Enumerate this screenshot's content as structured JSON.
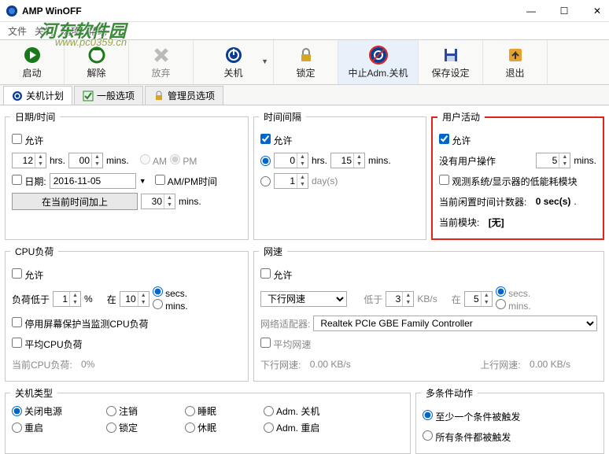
{
  "title": "AMP WinOFF",
  "menu": {
    "file": "文件",
    "shutdown": "关机",
    "options": "选项",
    "help": "帮助"
  },
  "watermark": {
    "line1": "河东软件园",
    "line2": "www.pc0359.cn"
  },
  "toolbar": {
    "start": "启动",
    "cancel": "解除",
    "abort": "放弃",
    "shut": "关机",
    "lock": "锁定",
    "admShut": "中止Adm.关机",
    "save": "保存设定",
    "exit": "退出"
  },
  "tabs": {
    "plan": "关机计划",
    "general": "一般选项",
    "admin": "管理员选项"
  },
  "datetime": {
    "title": "日期/时间",
    "allow": "允许",
    "hrs": "12",
    "hrsLbl": "hrs.",
    "mins": "00",
    "minsLbl": "mins.",
    "am": "AM",
    "pm": "PM",
    "dateChk": "日期:",
    "dateVal": "2016-11-05",
    "ampm": "AM/PM时间",
    "addBtn": "在当前时间加上",
    "addVal": "30",
    "addUnit": "mins."
  },
  "interval": {
    "title": "时间间隔",
    "allow": "允许",
    "v1": "0",
    "u1": "hrs.",
    "v2": "15",
    "u2": "mins.",
    "v3": "1",
    "u3": "day(s)"
  },
  "activity": {
    "title": "用户活动",
    "allow": "允许",
    "noInput": "没有用户操作",
    "v": "5",
    "u": "mins.",
    "monitor": "观测系统/显示器的低能耗模块",
    "idleLbl": "当前闲置时间计数器:",
    "idleVal": "0 sec(s)",
    "modLbl": "当前模块:",
    "modVal": "[无]"
  },
  "cpu": {
    "title": "CPU负荷",
    "allow": "允许",
    "below": "负荷低于",
    "v1": "1",
    "pct": "%",
    "at": "在",
    "v2": "10",
    "secs": "secs.",
    "mins": "mins.",
    "screensaver": "停用屏幕保护当监测CPU负荷",
    "avg": "平均CPU负荷",
    "cur": "当前CPU负荷:",
    "curV": "0%"
  },
  "net": {
    "title": "网速",
    "allow": "允许",
    "dir": "下行网速",
    "below": "低于",
    "v1": "3",
    "kbs": "KB/s",
    "at": "在",
    "v2": "5",
    "secs": "secs.",
    "mins": "mins.",
    "adapter": "网络适配器:",
    "adapterV": "Realtek PCIe GBE Family Controller",
    "avg": "平均网速",
    "dn": "下行网速:",
    "dnV": "0.00 KB/s",
    "up": "上行网速:",
    "upV": "0.00 KB/s"
  },
  "stype": {
    "title": "关机类型",
    "poweroff": "关闭电源",
    "logoff": "注销",
    "sleep": "睡眠",
    "admShut": "Adm. 关机",
    "reboot": "重启",
    "lock": "锁定",
    "hibernate": "休眠",
    "admReboot": "Adm. 重启"
  },
  "cond": {
    "title": "多条件动作",
    "any": "至少一个条件被触发",
    "all": "所有条件都被触发"
  }
}
